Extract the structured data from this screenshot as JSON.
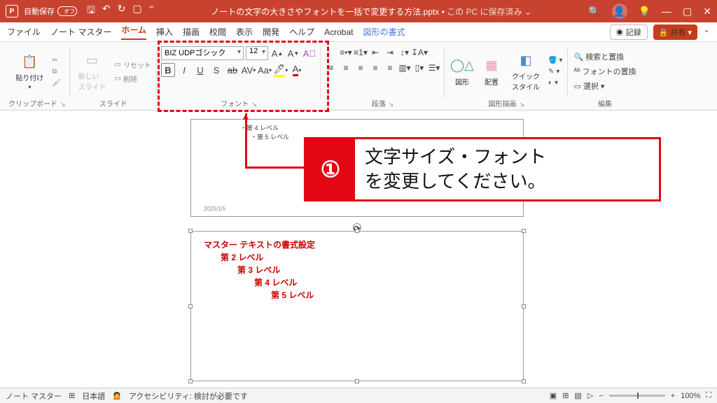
{
  "titlebar": {
    "autosave_label": "自動保存",
    "autosave_state": "オフ",
    "filename": "ノートの文字の大きさやフォントを一括で変更する方法.pptx",
    "saved_status": "この PC に保存済み"
  },
  "menu": {
    "items": [
      "ファイル",
      "ノート マスター",
      "ホーム",
      "挿入",
      "描画",
      "校閲",
      "表示",
      "開発",
      "ヘルプ",
      "Acrobat",
      "図形の書式"
    ],
    "active": "ホーム",
    "record": "記録",
    "share": "共有"
  },
  "ribbon": {
    "clipboard": {
      "paste": "貼り付け",
      "label": "クリップボード"
    },
    "slides": {
      "new": "新しい\nスライド",
      "reset": "リセット",
      "delete": "削除",
      "label": "スライド"
    },
    "font": {
      "name": "BIZ UDPゴシック",
      "size": "12",
      "label": "フォント"
    },
    "paragraph": {
      "label": "段落"
    },
    "drawing": {
      "shapes": "図形",
      "arrange": "配置",
      "quick": "クイック\nスタイル",
      "label": "図形描画"
    },
    "editing": {
      "find": "検索と置換",
      "replace": "フォントの置換",
      "select": "選択",
      "label": "編集"
    }
  },
  "callout": {
    "num": "①",
    "text": "文字サイズ・フォント\nを変更してください。"
  },
  "slide": {
    "bullets": [
      "・第 4 レベル",
      "　・第 5 レベル"
    ],
    "date": "2025/1/5"
  },
  "notes": {
    "l1": "マスター テキストの書式設定",
    "l2": "第 2 レベル",
    "l3": "第 3 レベル",
    "l4": "第 4 レベル",
    "l5": "第 5 レベル"
  },
  "status": {
    "view": "ノート マスター",
    "lang": "日本語",
    "a11y": "アクセシビリティ: 検討が必要です",
    "zoom": "100%"
  }
}
